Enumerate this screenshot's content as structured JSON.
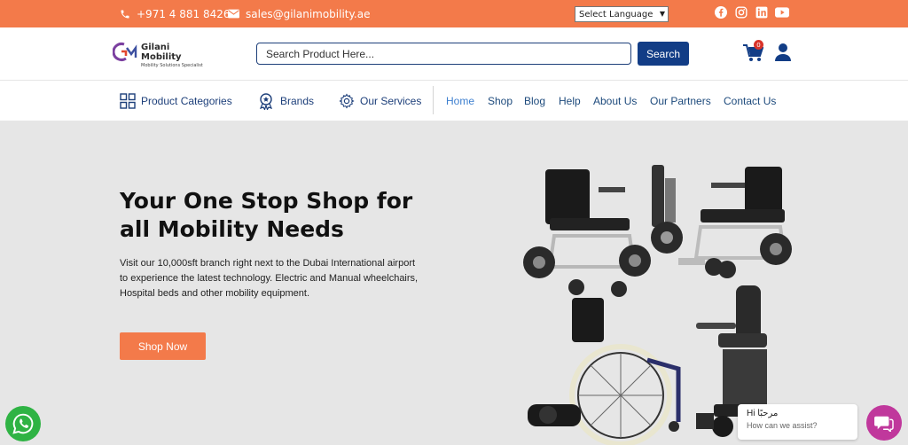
{
  "topbar": {
    "phone": "+971 4 881 8426",
    "email": "sales@gilanimobility.ae",
    "language_select": "Select Language",
    "social_icons": [
      "facebook-icon",
      "instagram-icon",
      "linkedin-icon",
      "youtube-icon"
    ],
    "bg_color": "#f37a4a"
  },
  "header": {
    "logo_name": "Gilani Mobility",
    "logo_tagline": "Mobility Solutions Specialist",
    "search_placeholder": "Search Product Here...",
    "search_button": "Search",
    "cart_count": "0",
    "accent_color": "#123d86"
  },
  "nav": {
    "mega": [
      {
        "label": "Product Categories",
        "icon": "grid-icon"
      },
      {
        "label": "Brands",
        "icon": "badge-icon"
      },
      {
        "label": "Our Services",
        "icon": "gear-icon"
      }
    ],
    "links": [
      "Home",
      "Shop",
      "Blog",
      "Help",
      "About Us",
      "Our Partners",
      "Contact Us"
    ],
    "active": "Home"
  },
  "hero": {
    "title": "Your One Stop Shop for all Mobility Needs",
    "text": "Visit our 10,000sft branch right next to the Dubai International airport to experience the latest technology. Electric and Manual wheelchairs, Hospital beds and other mobility equipment.",
    "button": "Shop Now",
    "image": "wheelchairs-collage"
  },
  "chat": {
    "greeting": "Hi مرحبًا",
    "prompt": "How can we assist?",
    "whatsapp_color": "#2fb344",
    "chat_color": "#c0389c"
  }
}
